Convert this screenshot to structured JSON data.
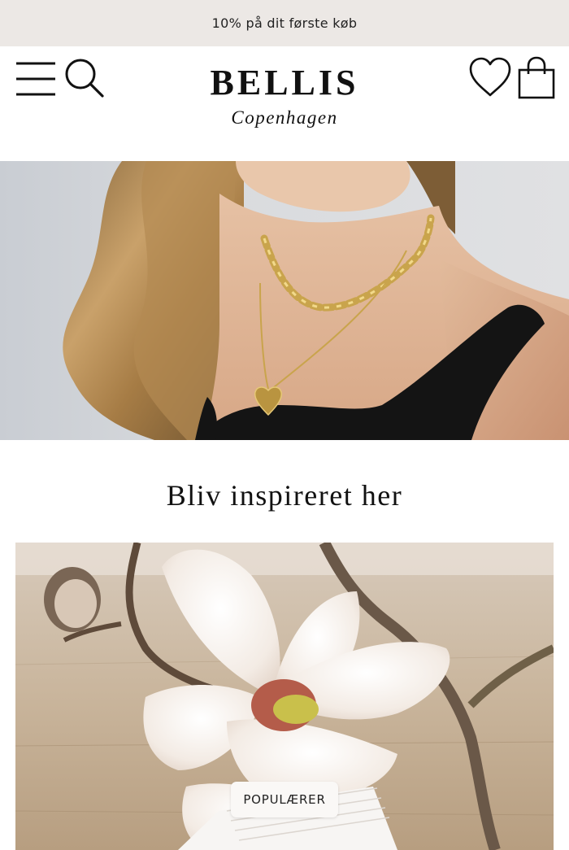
{
  "announcement": {
    "text": "10% på dit første køb"
  },
  "header": {
    "logo_title": "BELLIS",
    "logo_subtitle": "Copenhagen",
    "icons": {
      "menu": "hamburger-menu-icon",
      "search": "search-icon",
      "wishlist": "heart-icon",
      "cart": "shopping-bag-icon"
    }
  },
  "hero": {
    "image": "model-wearing-gold-necklaces"
  },
  "inspiration": {
    "title": "Bliv inspireret her",
    "feature_image": "magnolia-flower-on-wooden-table",
    "badge_label": "POPULÆRER"
  },
  "colors": {
    "announcement_bg": "#ece8e5",
    "text": "#111111",
    "gold": "#c9a44c"
  }
}
